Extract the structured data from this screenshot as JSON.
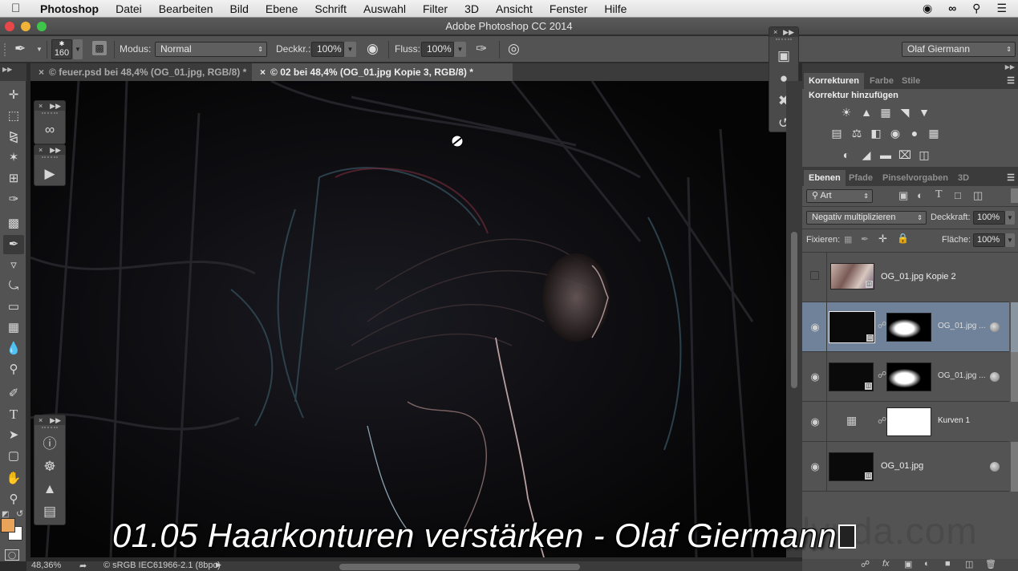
{
  "menubar": {
    "apple_icon": "apple-icon",
    "app_name": "Photoshop",
    "items": [
      "Datei",
      "Bearbeiten",
      "Bild",
      "Ebene",
      "Schrift",
      "Auswahl",
      "Filter",
      "3D",
      "Ansicht",
      "Fenster",
      "Hilfe"
    ],
    "status_icons": [
      "record-icon",
      "creative-cloud-icon",
      "spotlight-search-icon",
      "notification-list-icon"
    ]
  },
  "window": {
    "title": "Adobe Photoshop CC 2014"
  },
  "options_bar": {
    "brush_size": "160",
    "mode_label": "Modus:",
    "mode_value": "Normal",
    "opacity_label": "Deckkr.:",
    "opacity_value": "100%",
    "flow_label": "Fluss:",
    "flow_value": "100%",
    "workspace": "Olaf Giermann"
  },
  "doc_tabs": [
    {
      "label": "© feuer.psd bei 48,4% (OG_01.jpg, RGB/8) *",
      "active": false
    },
    {
      "label": "© 02 bei 48,4% (OG_01.jpg Kopie 3, RGB/8) *",
      "active": true
    }
  ],
  "toolbar": {
    "tools": [
      "move-tool",
      "marquee-tool",
      "lasso-tool",
      "magic-wand-tool",
      "crop-tool",
      "eyedropper-tool",
      "healing-brush-tool",
      "brush-tool",
      "stamp-tool",
      "history-brush-tool",
      "eraser-tool",
      "gradient-tool",
      "blur-tool",
      "dodge-tool",
      "pen-tool",
      "type-tool",
      "path-selection-tool",
      "shape-tool",
      "hand-tool",
      "zoom-tool"
    ],
    "active_tool": "brush-tool",
    "foreground_color": "#e9a45a",
    "background_color": "#ffffff"
  },
  "panels": {
    "adjustments": {
      "tabs": [
        "Korrekturen",
        "Farbe",
        "Stile"
      ],
      "active_tab": "Korrekturen",
      "heading": "Korrektur hinzufügen"
    },
    "layers": {
      "tabs": [
        "Ebenen",
        "Pfade",
        "Pinselvorgaben",
        "3D"
      ],
      "active_tab": "Ebenen",
      "filter_label": "Art",
      "blend_mode": "Negativ multiplizieren",
      "opacity_label": "Deckkraft:",
      "opacity_value": "100%",
      "lock_label": "Fixieren:",
      "fill_label": "Fläche:",
      "fill_value": "100%",
      "items": [
        {
          "name": "OG_01.jpg Kopie 2",
          "visible": false,
          "selected": false,
          "has_mask": false
        },
        {
          "name": "OG_01.jpg ...",
          "visible": true,
          "selected": true,
          "has_mask": true
        },
        {
          "name": "OG_01.jpg ...",
          "visible": true,
          "selected": false,
          "has_mask": true
        },
        {
          "name": "Kurven 1",
          "visible": true,
          "selected": false,
          "has_mask": true
        },
        {
          "name": "OG_01.jpg",
          "visible": true,
          "selected": false,
          "has_mask": false
        }
      ]
    }
  },
  "status_bar": {
    "zoom": "48,36%",
    "profile": "© sRGB IEC61966-2.1 (8bpc)"
  },
  "overlay": {
    "subtitle": "01.05 Haarkonturen verstärken - Olaf Giermann",
    "watermark": "lynda.com"
  }
}
